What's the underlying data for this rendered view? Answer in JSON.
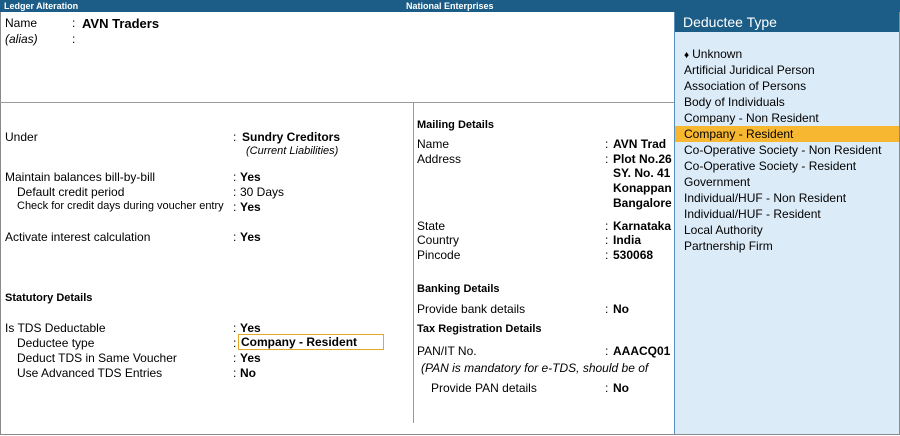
{
  "header": {
    "title": "Ledger Alteration",
    "company": "National Enterprises"
  },
  "ledger": {
    "name_label": "Name",
    "name_value": "AVN Traders",
    "alias_label": "(alias)",
    "colon": ":"
  },
  "left": {
    "under_label": "Under",
    "under_value": "Sundry Creditors",
    "under_sub": "(Current Liabilities)",
    "bill_label": "Maintain balances bill-by-bill",
    "bill_value": "Yes",
    "credit_label": "Default credit period",
    "credit_value": "30 Days",
    "check_label": "Check for credit days during voucher entry",
    "check_value": "Yes",
    "interest_label": "Activate interest calculation",
    "interest_value": "Yes",
    "statutory_heading": "Statutory Details",
    "tds_label": "Is TDS Deductable",
    "tds_value": "Yes",
    "deductee_label": "Deductee type",
    "deductee_value": "Company - Resident",
    "same_voucher_label": "Deduct TDS in Same Voucher",
    "same_voucher_value": "Yes",
    "advanced_label": "Use Advanced TDS Entries",
    "advanced_value": "No"
  },
  "mailing": {
    "heading": "Mailing Details",
    "name_label": "Name",
    "name_value": "AVN Trad",
    "address_label": "Address",
    "address_lines": [
      "Plot No.26",
      "SY. No. 41",
      "Konappan",
      "Bangalore"
    ],
    "state_label": "State",
    "state_value": "Karnataka",
    "country_label": "Country",
    "country_value": "India",
    "pincode_label": "Pincode",
    "pincode_value": "530068"
  },
  "banking": {
    "heading": "Banking Details",
    "bank_label": "Provide bank details",
    "bank_value": "No"
  },
  "tax": {
    "heading": "Tax Registration Details",
    "pan_label": "PAN/IT No.",
    "pan_value": "AAACQ01",
    "pan_note": "(PAN is mandatory for e-TDS, should be of",
    "provide_pan_label": "Provide PAN details",
    "provide_pan_value": "No"
  },
  "deductee_panel": {
    "title": "Deductee Type",
    "bullet": "♦",
    "options": [
      "Unknown",
      "Artificial Juridical Person",
      "Association of Persons",
      "Body of Individuals",
      "Company - Non Resident",
      "Company - Resident",
      "Co-Operative Society - Non Resident",
      "Co-Operative Society - Resident",
      "Government",
      "Individual/HUF - Non Resident",
      "Individual/HUF - Resident",
      "Local Authority",
      "Partnership Firm"
    ],
    "selected_index": 5
  },
  "colors": {
    "header_bg": "#1b5d87",
    "highlight": "#f7b731",
    "panel_bg": "#dcebf8"
  }
}
